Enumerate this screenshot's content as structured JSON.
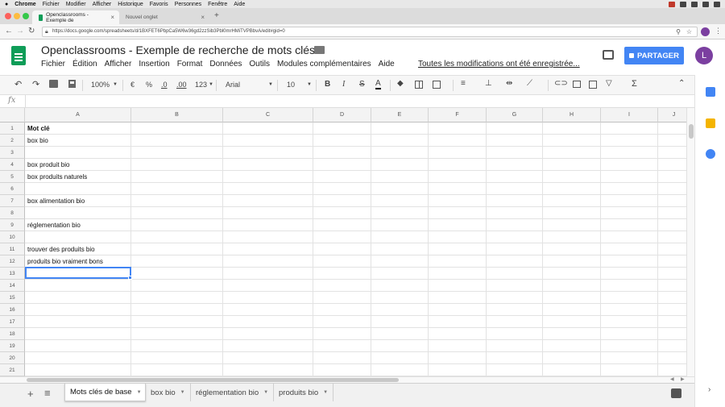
{
  "mac_menubar": {
    "items": [
      "Chrome",
      "Fichier",
      "Modifier",
      "Afficher",
      "Historique",
      "Favoris",
      "Personnes",
      "Fenêtre",
      "Aide"
    ]
  },
  "browser": {
    "tabs": [
      {
        "label": "Openclassrooms - Exemple de"
      },
      {
        "label": "Nouvel onglet"
      }
    ],
    "new_tab": "+",
    "url": "https://docs.google.com/spreadsheets/d/1BXFET6PbpCa5W6w36gd2zzSib3Pbl0mrHMiTVPBbvA/edit#gid=0",
    "traffic_colors": [
      "#fc605c",
      "#fdbc40",
      "#34c84a"
    ]
  },
  "doc": {
    "title": "Openclassrooms - Exemple de recherche de mots clés",
    "menus": [
      "Fichier",
      "Édition",
      "Afficher",
      "Insertion",
      "Format",
      "Données",
      "Outils",
      "Modules complémentaires",
      "Aide"
    ],
    "saved_message": "Toutes les modifications ont été enregistrée...",
    "share_label": "PARTAGER",
    "avatar_letter": "L",
    "brand_color": "#0f9d58",
    "share_color": "#4285f4"
  },
  "toolbar": {
    "zoom": "100%",
    "currency": "€",
    "percent": "%",
    "dec_less": ".0",
    "dec_more": ".00",
    "more_formats": "123",
    "font": "Arial",
    "font_size": "10",
    "bold": "B",
    "italic": "I",
    "strike": "S",
    "text_color": "A",
    "functions": "Σ"
  },
  "formula_bar": {
    "label": "fx",
    "value": ""
  },
  "grid": {
    "columns": [
      "A",
      "B",
      "C",
      "D",
      "E",
      "F",
      "G",
      "H",
      "I",
      "J"
    ],
    "rows": [
      "1",
      "2",
      "3",
      "4",
      "5",
      "6",
      "7",
      "8",
      "9",
      "10",
      "11",
      "12",
      "13",
      "14",
      "15",
      "16",
      "17",
      "18",
      "19",
      "20",
      "21"
    ],
    "column_a": [
      "Mot clé",
      "box bio",
      "",
      "box produit bio",
      "box produits naturels",
      "",
      "box alimentation bio",
      "",
      "réglementation bio",
      "",
      "trouver des produits bio",
      "produits bio vraiment bons",
      "",
      "",
      "",
      "",
      "",
      "",
      "",
      "",
      ""
    ],
    "selected_cell": "A13"
  },
  "sheets": {
    "add": "+",
    "all_sheets": "≡",
    "tabs": [
      {
        "label": "Mots clés de base"
      },
      {
        "label": "box bio"
      },
      {
        "label": "réglementation bio"
      },
      {
        "label": "produits bio"
      }
    ],
    "active": "Mots clés de base"
  }
}
